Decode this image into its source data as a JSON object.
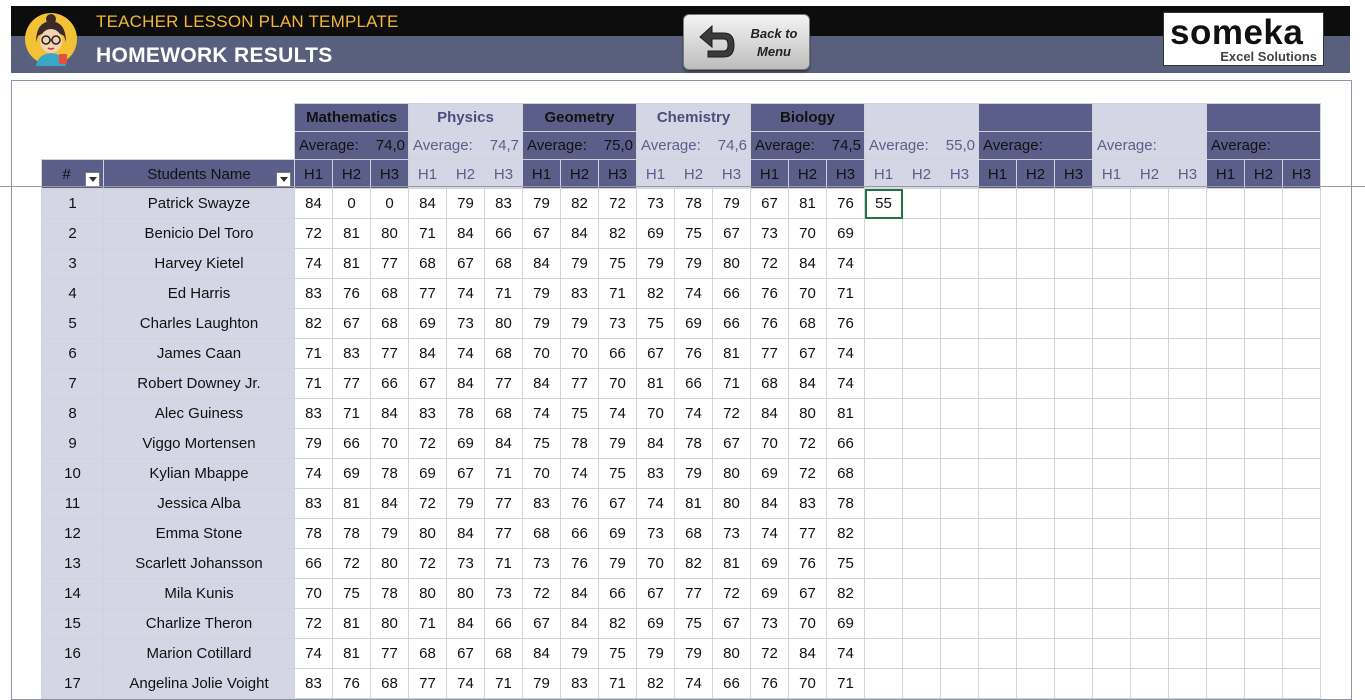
{
  "header": {
    "app_title": "TEACHER LESSON PLAN TEMPLATE",
    "page_title": "HOMEWORK RESULTS",
    "back_button": {
      "line1": "Back to",
      "line2": "Menu"
    },
    "logo": {
      "brand": "someka",
      "tagline": "Excel Solutions"
    }
  },
  "table": {
    "num_header": "#",
    "name_header": "Students Name",
    "average_label": "Average:",
    "hw_labels": [
      "H1",
      "H2",
      "H3"
    ],
    "subjects": [
      {
        "name": "Mathematics",
        "average": "74,0"
      },
      {
        "name": "Physics",
        "average": "74,7"
      },
      {
        "name": "Geometry",
        "average": "75,0"
      },
      {
        "name": "Chemistry",
        "average": "74,6"
      },
      {
        "name": "Biology",
        "average": "74,5"
      },
      {
        "name": "",
        "average": "55,0"
      },
      {
        "name": "",
        "average": ""
      },
      {
        "name": "",
        "average": ""
      },
      {
        "name": "",
        "average": ""
      }
    ],
    "students": [
      {
        "num": "1",
        "name": "Patrick Swayze",
        "scores": [
          "84",
          "0",
          "0",
          "84",
          "79",
          "83",
          "79",
          "82",
          "72",
          "73",
          "78",
          "79",
          "67",
          "81",
          "76",
          "55"
        ]
      },
      {
        "num": "2",
        "name": "Benicio Del Toro",
        "scores": [
          "72",
          "81",
          "80",
          "71",
          "84",
          "66",
          "67",
          "84",
          "82",
          "69",
          "75",
          "67",
          "73",
          "70",
          "69"
        ]
      },
      {
        "num": "3",
        "name": "Harvey Kietel",
        "scores": [
          "74",
          "81",
          "77",
          "68",
          "67",
          "68",
          "84",
          "79",
          "75",
          "79",
          "79",
          "80",
          "72",
          "84",
          "74"
        ]
      },
      {
        "num": "4",
        "name": "Ed Harris",
        "scores": [
          "83",
          "76",
          "68",
          "77",
          "74",
          "71",
          "79",
          "83",
          "71",
          "82",
          "74",
          "66",
          "76",
          "70",
          "71"
        ]
      },
      {
        "num": "5",
        "name": "Charles Laughton",
        "scores": [
          "82",
          "67",
          "68",
          "69",
          "73",
          "80",
          "79",
          "79",
          "73",
          "75",
          "69",
          "66",
          "76",
          "68",
          "76"
        ]
      },
      {
        "num": "6",
        "name": "James Caan",
        "scores": [
          "71",
          "83",
          "77",
          "84",
          "74",
          "68",
          "70",
          "70",
          "66",
          "67",
          "76",
          "81",
          "77",
          "67",
          "74"
        ]
      },
      {
        "num": "7",
        "name": "Robert Downey Jr.",
        "scores": [
          "71",
          "77",
          "66",
          "67",
          "84",
          "77",
          "84",
          "77",
          "70",
          "81",
          "66",
          "71",
          "68",
          "84",
          "74"
        ]
      },
      {
        "num": "8",
        "name": "Alec Guiness",
        "scores": [
          "83",
          "71",
          "84",
          "83",
          "78",
          "68",
          "74",
          "75",
          "74",
          "70",
          "74",
          "72",
          "84",
          "80",
          "81"
        ]
      },
      {
        "num": "9",
        "name": "Viggo Mortensen",
        "scores": [
          "79",
          "66",
          "70",
          "72",
          "69",
          "84",
          "75",
          "78",
          "79",
          "84",
          "78",
          "67",
          "70",
          "72",
          "66"
        ]
      },
      {
        "num": "10",
        "name": "Kylian Mbappe",
        "scores": [
          "74",
          "69",
          "78",
          "69",
          "67",
          "71",
          "70",
          "74",
          "75",
          "83",
          "79",
          "80",
          "69",
          "72",
          "68"
        ]
      },
      {
        "num": "11",
        "name": "Jessica Alba",
        "scores": [
          "83",
          "81",
          "84",
          "72",
          "79",
          "77",
          "83",
          "76",
          "67",
          "74",
          "81",
          "80",
          "84",
          "83",
          "78"
        ]
      },
      {
        "num": "12",
        "name": "Emma Stone",
        "scores": [
          "78",
          "78",
          "79",
          "80",
          "84",
          "77",
          "68",
          "66",
          "69",
          "73",
          "68",
          "73",
          "74",
          "77",
          "82"
        ]
      },
      {
        "num": "13",
        "name": "Scarlett Johansson",
        "scores": [
          "66",
          "72",
          "80",
          "72",
          "73",
          "71",
          "73",
          "76",
          "79",
          "70",
          "82",
          "81",
          "69",
          "76",
          "75"
        ]
      },
      {
        "num": "14",
        "name": "Mila Kunis",
        "scores": [
          "70",
          "75",
          "78",
          "80",
          "80",
          "73",
          "72",
          "84",
          "66",
          "67",
          "77",
          "72",
          "69",
          "67",
          "82"
        ]
      },
      {
        "num": "15",
        "name": "Charlize Theron",
        "scores": [
          "72",
          "81",
          "80",
          "71",
          "84",
          "66",
          "67",
          "84",
          "82",
          "69",
          "75",
          "67",
          "73",
          "70",
          "69"
        ]
      },
      {
        "num": "16",
        "name": "Marion Cotillard",
        "scores": [
          "74",
          "81",
          "77",
          "68",
          "67",
          "68",
          "84",
          "79",
          "75",
          "79",
          "79",
          "80",
          "72",
          "84",
          "74"
        ]
      },
      {
        "num": "17",
        "name": "Angelina Jolie Voight",
        "scores": [
          "83",
          "76",
          "68",
          "77",
          "74",
          "71",
          "79",
          "83",
          "71",
          "82",
          "74",
          "66",
          "76",
          "70",
          "71"
        ]
      }
    ]
  },
  "colors": {
    "header_black": "#0d0d0d",
    "header_slate": "#59607d",
    "accent_gold": "#f2b538",
    "subject_dark": "#5c5e8a",
    "subject_light": "#d4d6e6",
    "selection": "#217346"
  },
  "icons": {
    "avatar": "teacher-avatar-icon",
    "back": "back-arrow-icon",
    "filter": "dropdown-filter-icon"
  }
}
